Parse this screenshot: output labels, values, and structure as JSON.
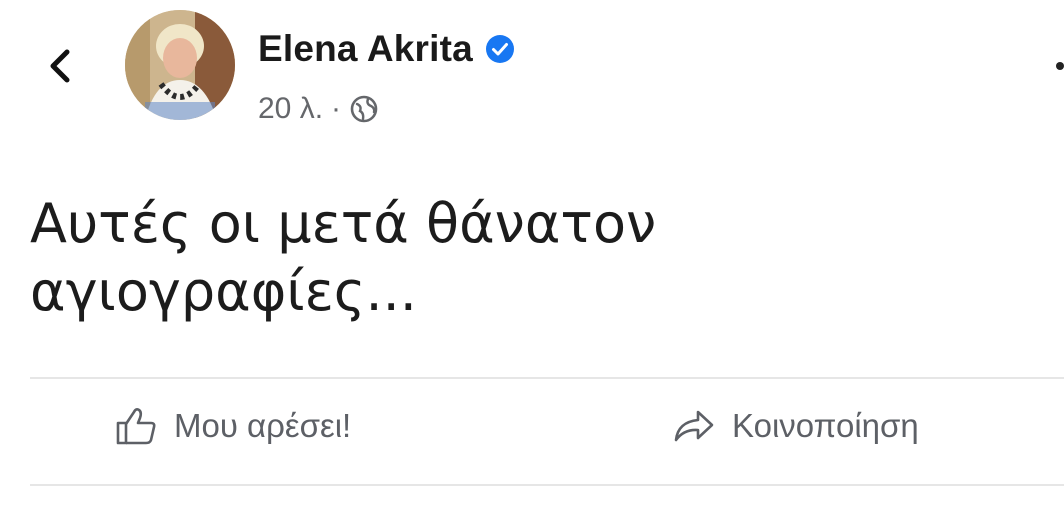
{
  "header": {
    "back_icon": "chevron-left-icon",
    "author_name": "Elena Akrita",
    "verified_icon": "verified-badge-icon",
    "timestamp": "20 λ.",
    "separator": "·",
    "audience_icon": "globe-icon",
    "more_icon": "more-options-icon"
  },
  "post": {
    "line1": "Αυτές οι μετά θάνατον",
    "line2": "αγιογραφίες..."
  },
  "actions": {
    "like_label": "Μου αρέσει!",
    "like_icon": "thumbs-up-icon",
    "share_label": "Κοινοποίηση",
    "share_icon": "share-arrow-icon"
  },
  "colors": {
    "verified_blue": "#1877f2",
    "secondary_text": "#65676b",
    "divider": "#e6e6e6"
  }
}
